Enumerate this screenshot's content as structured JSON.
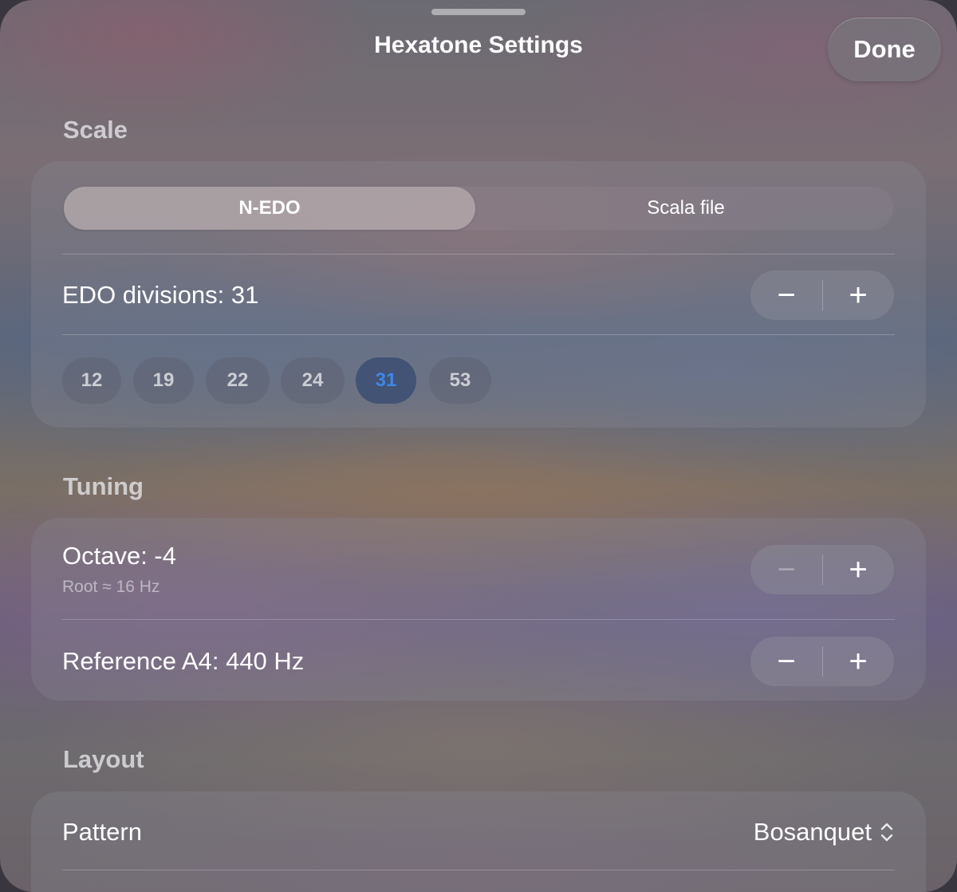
{
  "header": {
    "title": "Hexatone Settings",
    "done_label": "Done"
  },
  "scale": {
    "header": "Scale",
    "modes": [
      "N-EDO",
      "Scala file"
    ],
    "selected_mode": "N-EDO",
    "edo_label": "EDO divisions: 31",
    "edo_value": 31,
    "presets": [
      "12",
      "19",
      "22",
      "24",
      "31",
      "53"
    ],
    "selected_preset": "31"
  },
  "tuning": {
    "header": "Tuning",
    "octave_label": "Octave: -4",
    "octave_sub": "Root ≈ 16 Hz",
    "octave_minus_enabled": false,
    "reference_label": "Reference A4: 440 Hz"
  },
  "layout": {
    "header": "Layout",
    "pattern_label": "Pattern",
    "pattern_value": "Bosanquet"
  },
  "stepper": {
    "minus": "−",
    "plus": "+"
  },
  "colors": {
    "accent": "#3f86e6"
  },
  "icons": {
    "done": "done-button",
    "stepper_minus": "minus-icon",
    "stepper_plus": "plus-icon",
    "picker": "chevron-up-down-icon"
  }
}
